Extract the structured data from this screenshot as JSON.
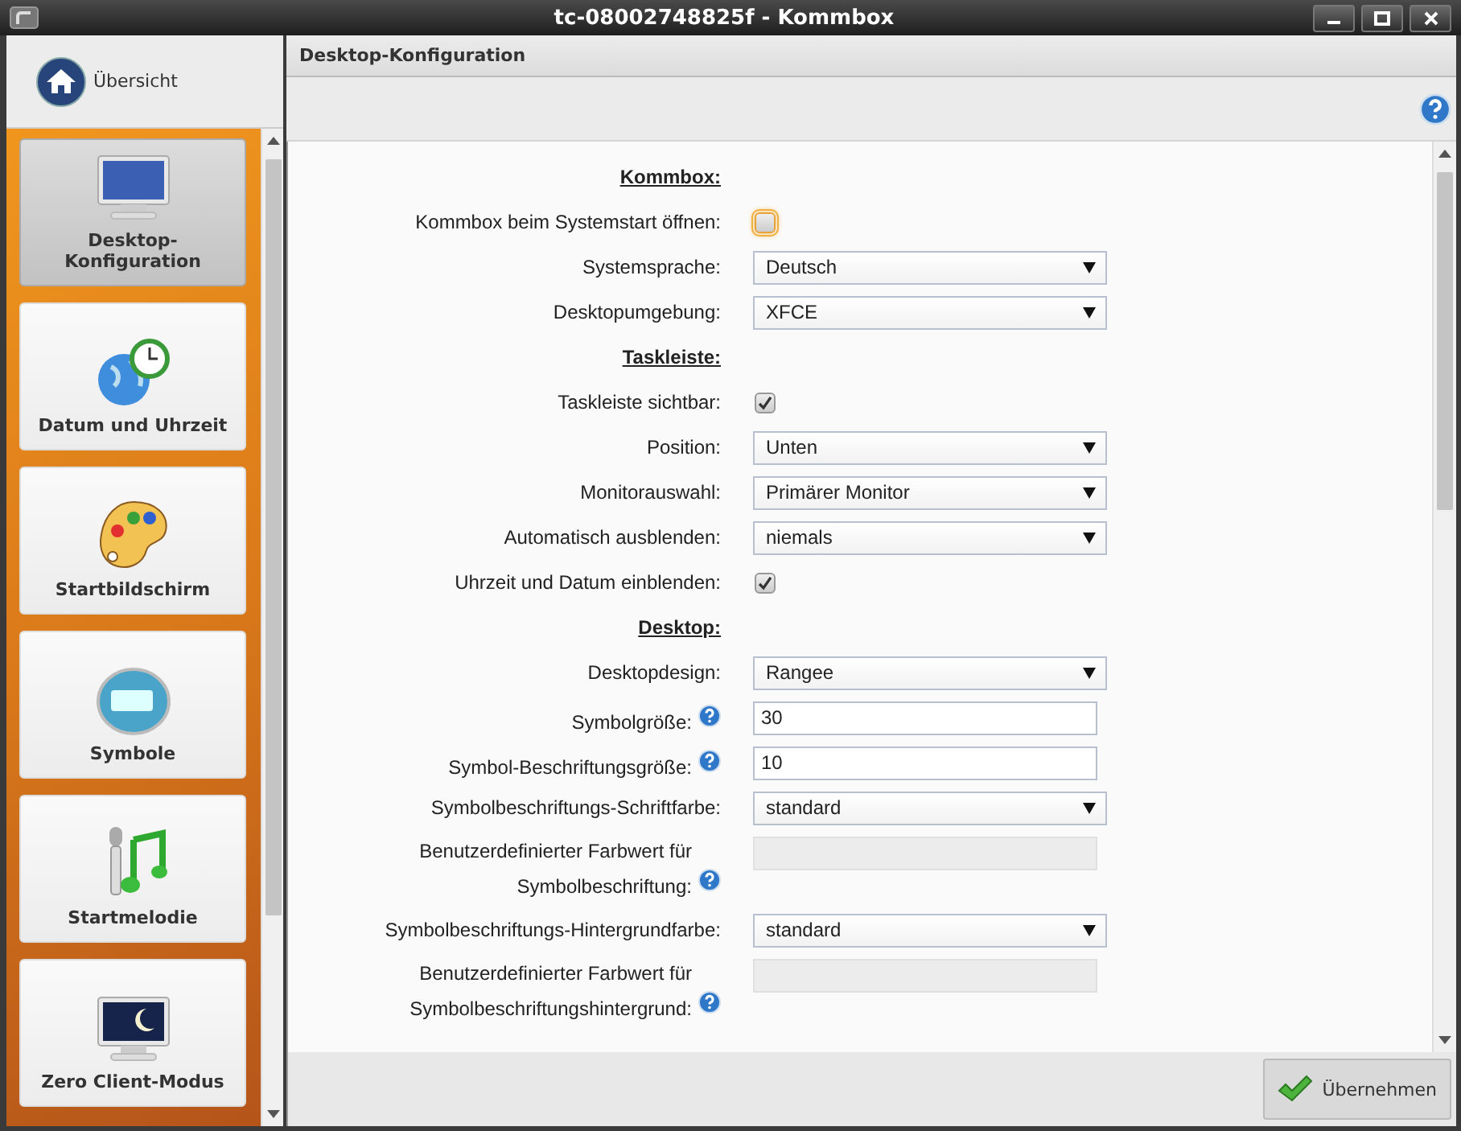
{
  "window": {
    "title": "tc-08002748825f - Kommbox"
  },
  "sidebar": {
    "overview": {
      "label": "Übersicht"
    },
    "items": [
      {
        "label": "Desktop-Konfiguration",
        "kind": "monitor",
        "selected": true
      },
      {
        "label": "Datum und Uhrzeit",
        "kind": "globe-clock",
        "selected": false
      },
      {
        "label": "Startbildschirm",
        "kind": "palette",
        "selected": false
      },
      {
        "label": "Symbole",
        "kind": "icons",
        "selected": false
      },
      {
        "label": "Startmelodie",
        "kind": "music",
        "selected": false
      },
      {
        "label": "Zero Client-Modus",
        "kind": "night-monitor",
        "selected": false
      }
    ]
  },
  "panel": {
    "title": "Desktop-Konfiguration"
  },
  "form": {
    "rows": [
      {
        "kind": "heading",
        "label": "Kommbox:"
      },
      {
        "kind": "checkbox",
        "label": "Kommbox beim Systemstart öffnen:",
        "checked": false,
        "focused": true
      },
      {
        "kind": "select",
        "label": "Systemsprache:",
        "value": "Deutsch"
      },
      {
        "kind": "select",
        "label": "Desktopumgebung:",
        "value": "XFCE"
      },
      {
        "kind": "heading",
        "label": "Taskleiste:"
      },
      {
        "kind": "checkbox",
        "label": "Taskleiste sichtbar:",
        "checked": true,
        "focused": false
      },
      {
        "kind": "select",
        "label": "Position:",
        "value": "Unten"
      },
      {
        "kind": "select",
        "label": "Monitorauswahl:",
        "value": "Primärer Monitor"
      },
      {
        "kind": "select",
        "label": "Automatisch ausblenden:",
        "value": "niemals"
      },
      {
        "kind": "checkbox",
        "label": "Uhrzeit und Datum einblenden:",
        "checked": true,
        "focused": false
      },
      {
        "kind": "heading",
        "label": "Desktop:"
      },
      {
        "kind": "select",
        "label": "Desktopdesign:",
        "value": "Rangee"
      },
      {
        "kind": "text",
        "label": "Symbolgröße:",
        "value": "30",
        "help": true
      },
      {
        "kind": "text",
        "label": "Symbol-Beschriftungsgröße:",
        "value": "10",
        "help": true
      },
      {
        "kind": "select",
        "label": "Symbolbeschriftungs-Schriftfarbe:",
        "value": "standard"
      },
      {
        "kind": "disabled-text",
        "label": "Benutzerdefinierter Farbwert für Symbolbeschriftung:",
        "help": true
      },
      {
        "kind": "select",
        "label": "Symbolbeschriftungs-Hintergrundfarbe:",
        "value": "standard"
      },
      {
        "kind": "disabled-text",
        "label": "Benutzerdefinierter Farbwert für Symbolbeschriftungshintergrund:",
        "help": true
      }
    ]
  },
  "footer": {
    "apply_button": "Übernehmen"
  }
}
